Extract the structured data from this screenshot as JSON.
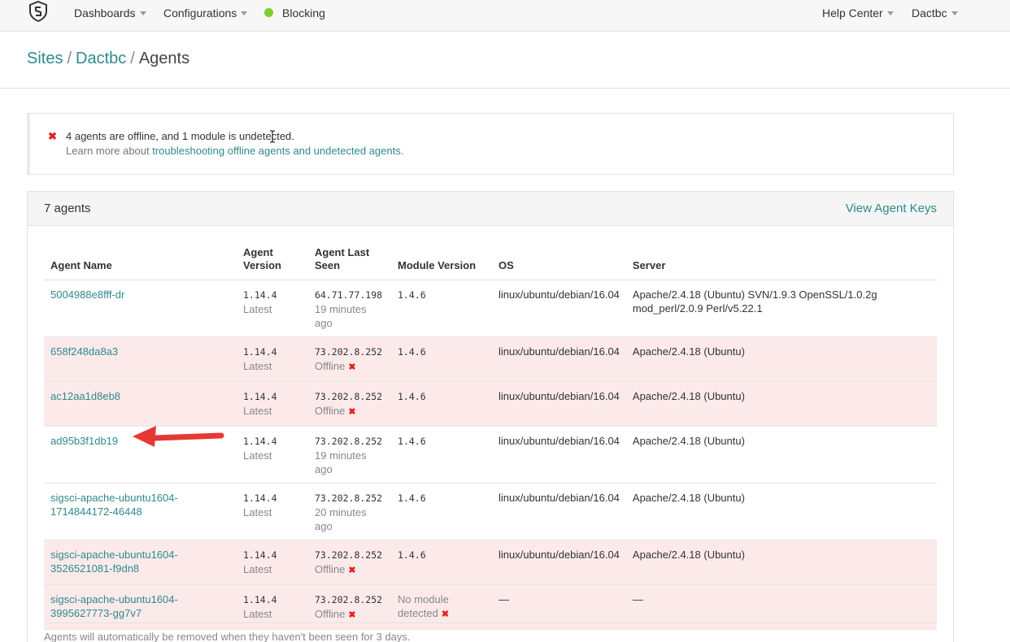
{
  "nav": {
    "dashboards": "Dashboards",
    "configurations": "Configurations",
    "blocking": "Blocking",
    "help": "Help Center",
    "user": "Dactbc"
  },
  "breadcrumb": {
    "sites": "Sites",
    "site": "Dactbc",
    "current": "Agents",
    "sep": "/"
  },
  "alert": {
    "icon": "✖",
    "message": "4 agents are offline, and 1 module is undetected.",
    "learn_prefix": "Learn more about ",
    "learn_link": "troubleshooting offline agents and undetected agents",
    "learn_suffix": "."
  },
  "panel": {
    "count": "7 agents",
    "view_keys": "View Agent Keys",
    "footnote": "Agents will automatically be removed when they haven't been seen for 3 days."
  },
  "table": {
    "headers": {
      "name": "Agent Name",
      "version_1": "Agent",
      "version_2": "Version",
      "seen_1": "Agent Last",
      "seen_2": "Seen",
      "module": "Module Version",
      "os": "OS",
      "server": "Server"
    },
    "rows": [
      {
        "name1": "5004988e8fff-dr",
        "name2": "",
        "version": "1.14.4",
        "version_sub": "Latest",
        "ip": "64.71.77.198",
        "seen1": "19 minutes",
        "seen2": "ago",
        "module": "1.4.6",
        "module_sub": "",
        "os": "linux/ubuntu/debian/16.04",
        "server1": "Apache/2.4.18 (Ubuntu) SVN/1.9.3 OpenSSL/1.0.2g",
        "server2": "mod_perl/2.0.9 Perl/v5.22.1"
      },
      {
        "name1": "658f248da8a3",
        "name2": "",
        "version": "1.14.4",
        "version_sub": "Latest",
        "ip": "73.202.8.252",
        "seen1": "Offline",
        "seen2": "",
        "module": "1.4.6",
        "module_sub": "",
        "os": "linux/ubuntu/debian/16.04",
        "server1": "Apache/2.4.18 (Ubuntu)",
        "server2": ""
      },
      {
        "name1": "ac12aa1d8eb8",
        "name2": "",
        "version": "1.14.4",
        "version_sub": "Latest",
        "ip": "73.202.8.252",
        "seen1": "Offline",
        "seen2": "",
        "module": "1.4.6",
        "module_sub": "",
        "os": "linux/ubuntu/debian/16.04",
        "server1": "Apache/2.4.18 (Ubuntu)",
        "server2": ""
      },
      {
        "name1": "ad95b3f1db19",
        "name2": "",
        "version": "1.14.4",
        "version_sub": "Latest",
        "ip": "73.202.8.252",
        "seen1": "19 minutes",
        "seen2": "ago",
        "module": "1.4.6",
        "module_sub": "",
        "os": "linux/ubuntu/debian/16.04",
        "server1": "Apache/2.4.18 (Ubuntu)",
        "server2": ""
      },
      {
        "name1": "sigsci-apache-ubuntu1604-",
        "name2": "1714844172-46448",
        "version": "1.14.4",
        "version_sub": "Latest",
        "ip": "73.202.8.252",
        "seen1": "20 minutes",
        "seen2": "ago",
        "module": "1.4.6",
        "module_sub": "",
        "os": "linux/ubuntu/debian/16.04",
        "server1": "Apache/2.4.18 (Ubuntu)",
        "server2": ""
      },
      {
        "name1": "sigsci-apache-ubuntu1604-",
        "name2": "3526521081-f9dn8",
        "version": "1.14.4",
        "version_sub": "Latest",
        "ip": "73.202.8.252",
        "seen1": "Offline",
        "seen2": "",
        "module": "1.4.6",
        "module_sub": "",
        "os": "linux/ubuntu/debian/16.04",
        "server1": "Apache/2.4.18 (Ubuntu)",
        "server2": ""
      },
      {
        "name1": "sigsci-apache-ubuntu1604-",
        "name2": "3995627773-gg7v7",
        "version": "1.14.4",
        "version_sub": "Latest",
        "ip": "73.202.8.252",
        "seen1": "Offline",
        "seen2": "",
        "module": "No module",
        "module_sub": "detected",
        "os": "—",
        "server1": "—",
        "server2": ""
      }
    ],
    "red_x": "✖"
  },
  "colors": {
    "link": "#2f8a8a",
    "offline_row": "#fceaea",
    "status_ok": "#7ccf32",
    "error": "#dd2222"
  }
}
